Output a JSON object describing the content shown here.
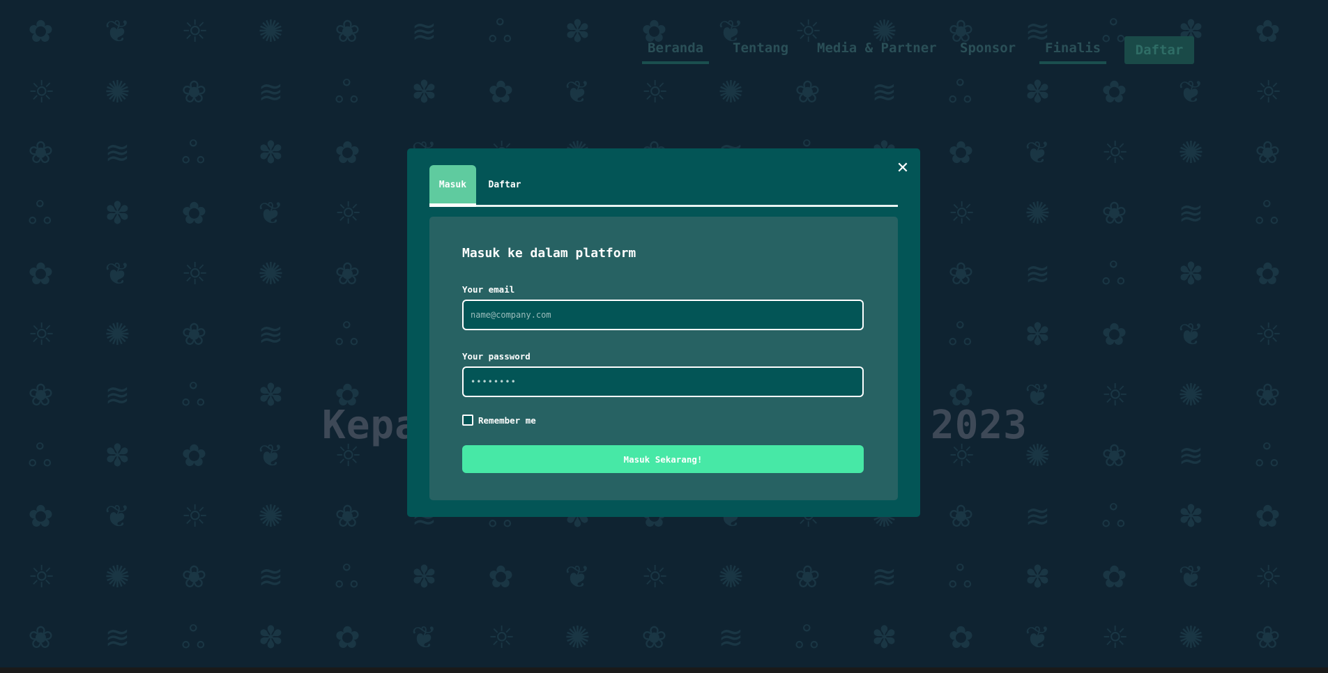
{
  "nav": {
    "items": [
      {
        "label": "Beranda",
        "active": true
      },
      {
        "label": "Tentang",
        "active": false
      },
      {
        "label": "Media & Partner",
        "active": false
      },
      {
        "label": "Sponsor",
        "active": false
      },
      {
        "label": "Finalis",
        "active": true
      }
    ],
    "cta_label": "Daftar"
  },
  "hero": {
    "title_left": "Kepa",
    "title_right": "2023"
  },
  "modal": {
    "close_icon": "close-icon",
    "tabs": [
      {
        "label": "Masuk",
        "active": true
      },
      {
        "label": "Daftar",
        "active": false
      }
    ],
    "title": "Masuk ke dalam platform",
    "email_label": "Your email",
    "email_placeholder": "name@company.com",
    "email_value": "",
    "password_label": "Your password",
    "password_placeholder": "••••••••",
    "password_value": "",
    "remember_label": "Remember me",
    "remember_checked": false,
    "submit_label": "Masuk Sekarang!"
  },
  "colors": {
    "background": "#0f2331",
    "modal": "#035556",
    "panel": "#276263",
    "tab_active": "#5fcb9f",
    "button": "#47e8a6"
  }
}
